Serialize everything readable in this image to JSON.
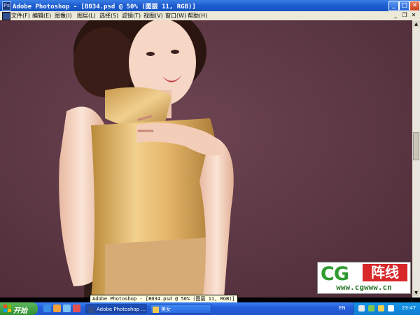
{
  "window": {
    "title": "Adobe Photoshop - [B034.psd @ 50% (图层 11, RGB)]",
    "buttons": {
      "minimize": "_",
      "maximize": "□",
      "close": "✕"
    }
  },
  "menu": {
    "items": [
      "文件(F)",
      "编辑(E)",
      "图像(I)",
      "图层(L)",
      "选择(S)",
      "滤镜(T)",
      "视图(V)",
      "窗口(W)",
      "帮助(H)"
    ],
    "mdi": {
      "minimize": "_",
      "restore": "❐",
      "close": "✕"
    }
  },
  "logo": {
    "cg": "CG",
    "zx": "阵线",
    "url": "www.cgwww.cn"
  },
  "tooltip": "Adobe Photoshop - [B034.psd @ 50% (图层 11, RGB)]",
  "taskbar": {
    "start": "开始",
    "tasks": [
      {
        "label": "Adobe Photoshop ...",
        "active": true
      },
      {
        "label": "美女",
        "active": false
      }
    ],
    "tray": {
      "lang": "EN",
      "time": "23:47"
    }
  },
  "colors": {
    "canvas": "#613a47",
    "accent": "#245edb"
  }
}
